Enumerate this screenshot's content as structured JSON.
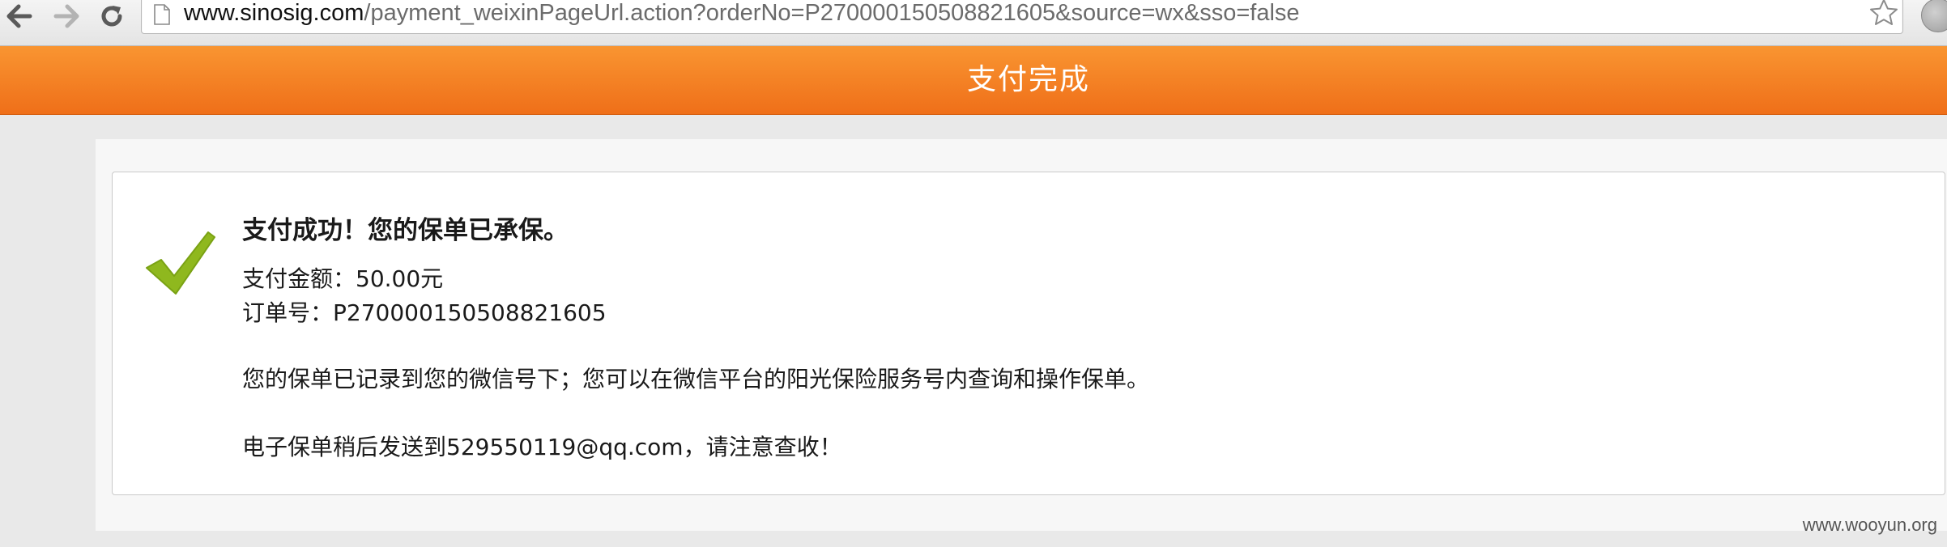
{
  "browser": {
    "url_domain": "www.sinosig.com",
    "url_path": "/payment_weixinPageUrl.action?orderNo=P270000150508821605&source=wx&sso=false"
  },
  "header": {
    "title": "支付完成"
  },
  "result": {
    "title": "支付成功！您的保单已承保。",
    "amount_line": "支付金额：50.00元",
    "order_line": "订单号：P270000150508821605",
    "policy_note": "您的保单已记录到您的微信号下；您可以在微信平台的阳光保险服务号内查询和操作保单。",
    "email_note": "电子保单稍后发送到529550119@qq.com，请注意查收！"
  },
  "watermark": "www.wooyun.org",
  "icons": {
    "back": "arrow-left-icon",
    "forward": "arrow-right-icon",
    "reload": "reload-icon",
    "page": "document-icon",
    "bookmark": "star-icon",
    "profile": "avatar-icon",
    "success": "checkmark-icon"
  },
  "colors": {
    "header_top": "#f99531",
    "header_bottom": "#ef6f19",
    "check_green": "#8fb81e"
  }
}
